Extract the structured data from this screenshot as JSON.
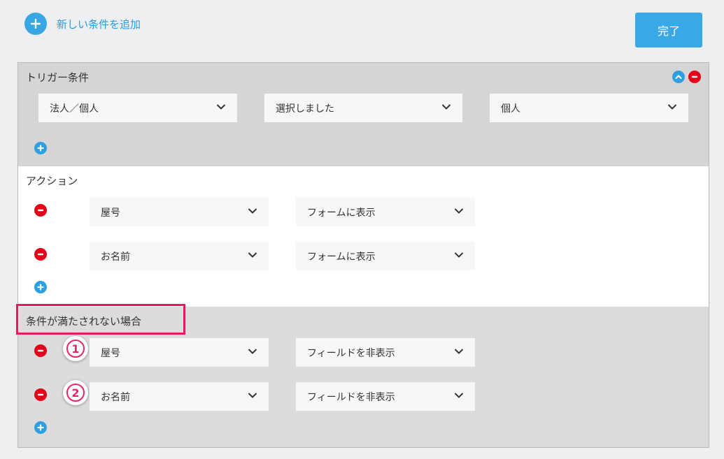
{
  "header": {
    "add_condition_label": "新しい条件を追加",
    "done_label": "完了"
  },
  "trigger": {
    "title": "トリガー条件",
    "selects": [
      "法人／個人",
      "選択しました",
      "個人"
    ]
  },
  "action": {
    "title": "アクション",
    "rows": [
      {
        "field": "屋号",
        "op": "フォームに表示"
      },
      {
        "field": "お名前",
        "op": "フォームに表示"
      }
    ]
  },
  "else": {
    "title": "条件が満たされない場合",
    "rows": [
      {
        "badge": "1",
        "field": "屋号",
        "op": "フィールドを非表示"
      },
      {
        "badge": "2",
        "field": "お名前",
        "op": "フィールドを非表示"
      }
    ]
  },
  "colors": {
    "accent": "#3aa8e6",
    "danger": "#e50019",
    "highlight": "#e8195f"
  }
}
